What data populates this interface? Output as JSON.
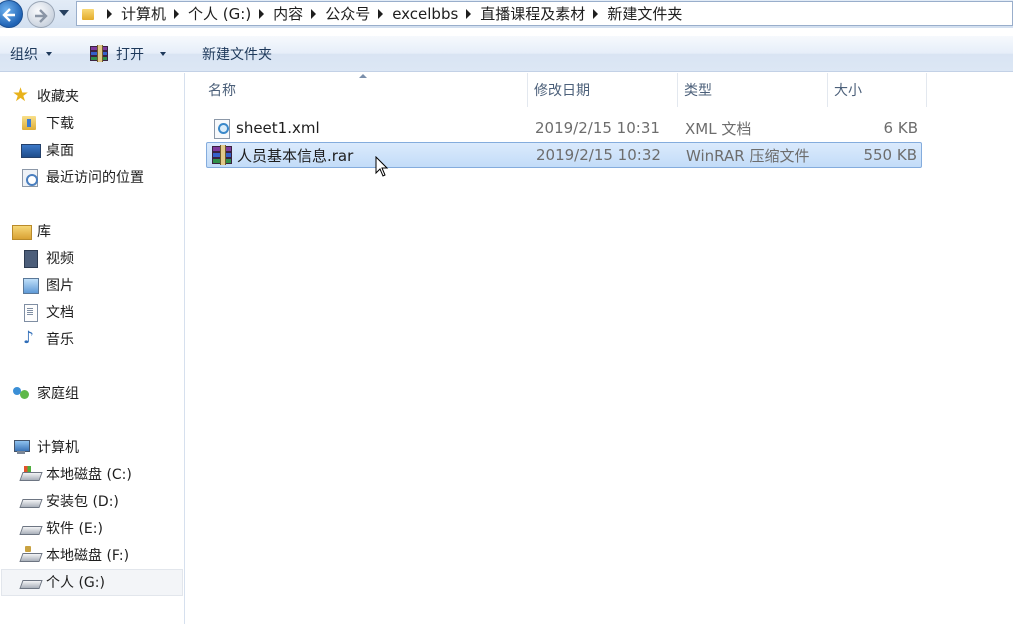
{
  "address_bar": {
    "crumbs": [
      "计算机",
      "个人 (G:)",
      "内容",
      "公众号",
      "excelbbs",
      "直播课程及素材",
      "新建文件夹"
    ]
  },
  "toolbar": {
    "organize_label": "组织",
    "open_label": "打开",
    "new_folder_label": "新建文件夹"
  },
  "nav_pane": {
    "favorites": {
      "label": "收藏夹",
      "icon": "star-icon",
      "items": [
        {
          "label": "下载",
          "icon": "downloads-folder-icon"
        },
        {
          "label": "桌面",
          "icon": "desktop-icon"
        },
        {
          "label": "最近访问的位置",
          "icon": "recent-places-icon"
        }
      ]
    },
    "libraries": {
      "label": "库",
      "icon": "library-icon",
      "items": [
        {
          "label": "视频",
          "icon": "video-library-icon"
        },
        {
          "label": "图片",
          "icon": "pictures-library-icon"
        },
        {
          "label": "文档",
          "icon": "documents-library-icon"
        },
        {
          "label": "音乐",
          "icon": "music-library-icon"
        }
      ]
    },
    "homegroup": {
      "label": "家庭组",
      "icon": "homegroup-icon"
    },
    "computer": {
      "label": "计算机",
      "icon": "computer-icon",
      "items": [
        {
          "label": "本地磁盘 (C:)",
          "icon": "system-drive-icon"
        },
        {
          "label": "安装包 (D:)",
          "icon": "drive-icon"
        },
        {
          "label": "软件 (E:)",
          "icon": "drive-icon"
        },
        {
          "label": "本地磁盘 (F:)",
          "icon": "usb-drive-icon"
        },
        {
          "label": "个人 (G:)",
          "icon": "drive-icon",
          "selected": true
        }
      ]
    }
  },
  "columns": {
    "name": "名称",
    "date": "修改日期",
    "type": "类型",
    "size": "大小"
  },
  "files": [
    {
      "name": "sheet1.xml",
      "date": "2019/2/15 10:31",
      "type": "XML 文档",
      "size": "6 KB",
      "icon": "xml-file-icon",
      "selected": false
    },
    {
      "name": "人员基本信息.rar",
      "date": "2019/2/15 10:32",
      "type": "WinRAR 压缩文件",
      "size": "550 KB",
      "icon": "winrar-archive-icon",
      "selected": true
    }
  ]
}
